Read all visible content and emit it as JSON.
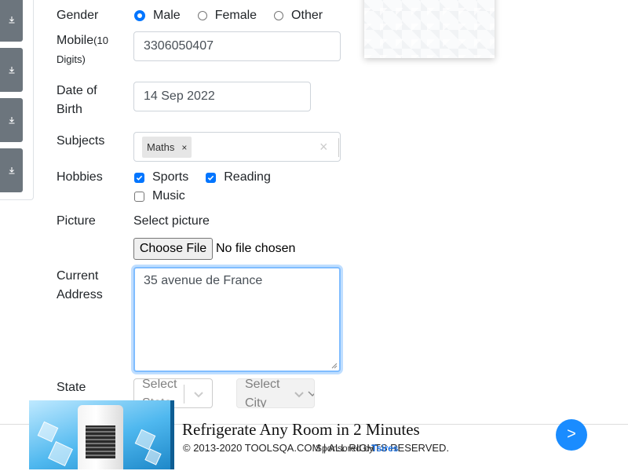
{
  "form": {
    "gender": {
      "label": "Gender",
      "options": [
        {
          "label": "Male",
          "checked": true
        },
        {
          "label": "Female",
          "checked": false
        },
        {
          "label": "Other",
          "checked": false
        }
      ]
    },
    "mobile": {
      "label": "Mobile",
      "hint": "(10",
      "hint2": "Digits)",
      "value": "3306050407"
    },
    "dob": {
      "label_line1": "Date of",
      "label_line2": "Birth",
      "value": "14 Sep 2022"
    },
    "subjects": {
      "label": "Subjects",
      "chips": [
        "Maths"
      ],
      "chip_remove": "×",
      "clear": "×"
    },
    "hobbies": {
      "label": "Hobbies",
      "options": [
        {
          "label": "Sports",
          "checked": true
        },
        {
          "label": "Reading",
          "checked": true
        },
        {
          "label": "Music",
          "checked": false
        }
      ]
    },
    "picture": {
      "label": "Picture",
      "prompt": "Select picture",
      "button": "Choose File",
      "status": "No file chosen"
    },
    "address": {
      "label_line1": "Current",
      "label_line2": "Address",
      "value": "35 avenue de France"
    },
    "state": {
      "label": "State",
      "placeholder": "Select State"
    },
    "city": {
      "placeholder": "Select City",
      "disabled": true
    }
  },
  "ad": {
    "title": "Refrigerate Any Room in 2 Minutes",
    "copyright": "© 2013-2020 TOOLSQA.COM | ALL RIGHTS RESERVED.",
    "sponsored_by": "Sponsored by",
    "sponsor": "Tsires",
    "next": ">"
  },
  "colors": {
    "accent": "#0075ff",
    "sidebar_button": "#6c757d",
    "ad_button": "#1a8cff"
  }
}
